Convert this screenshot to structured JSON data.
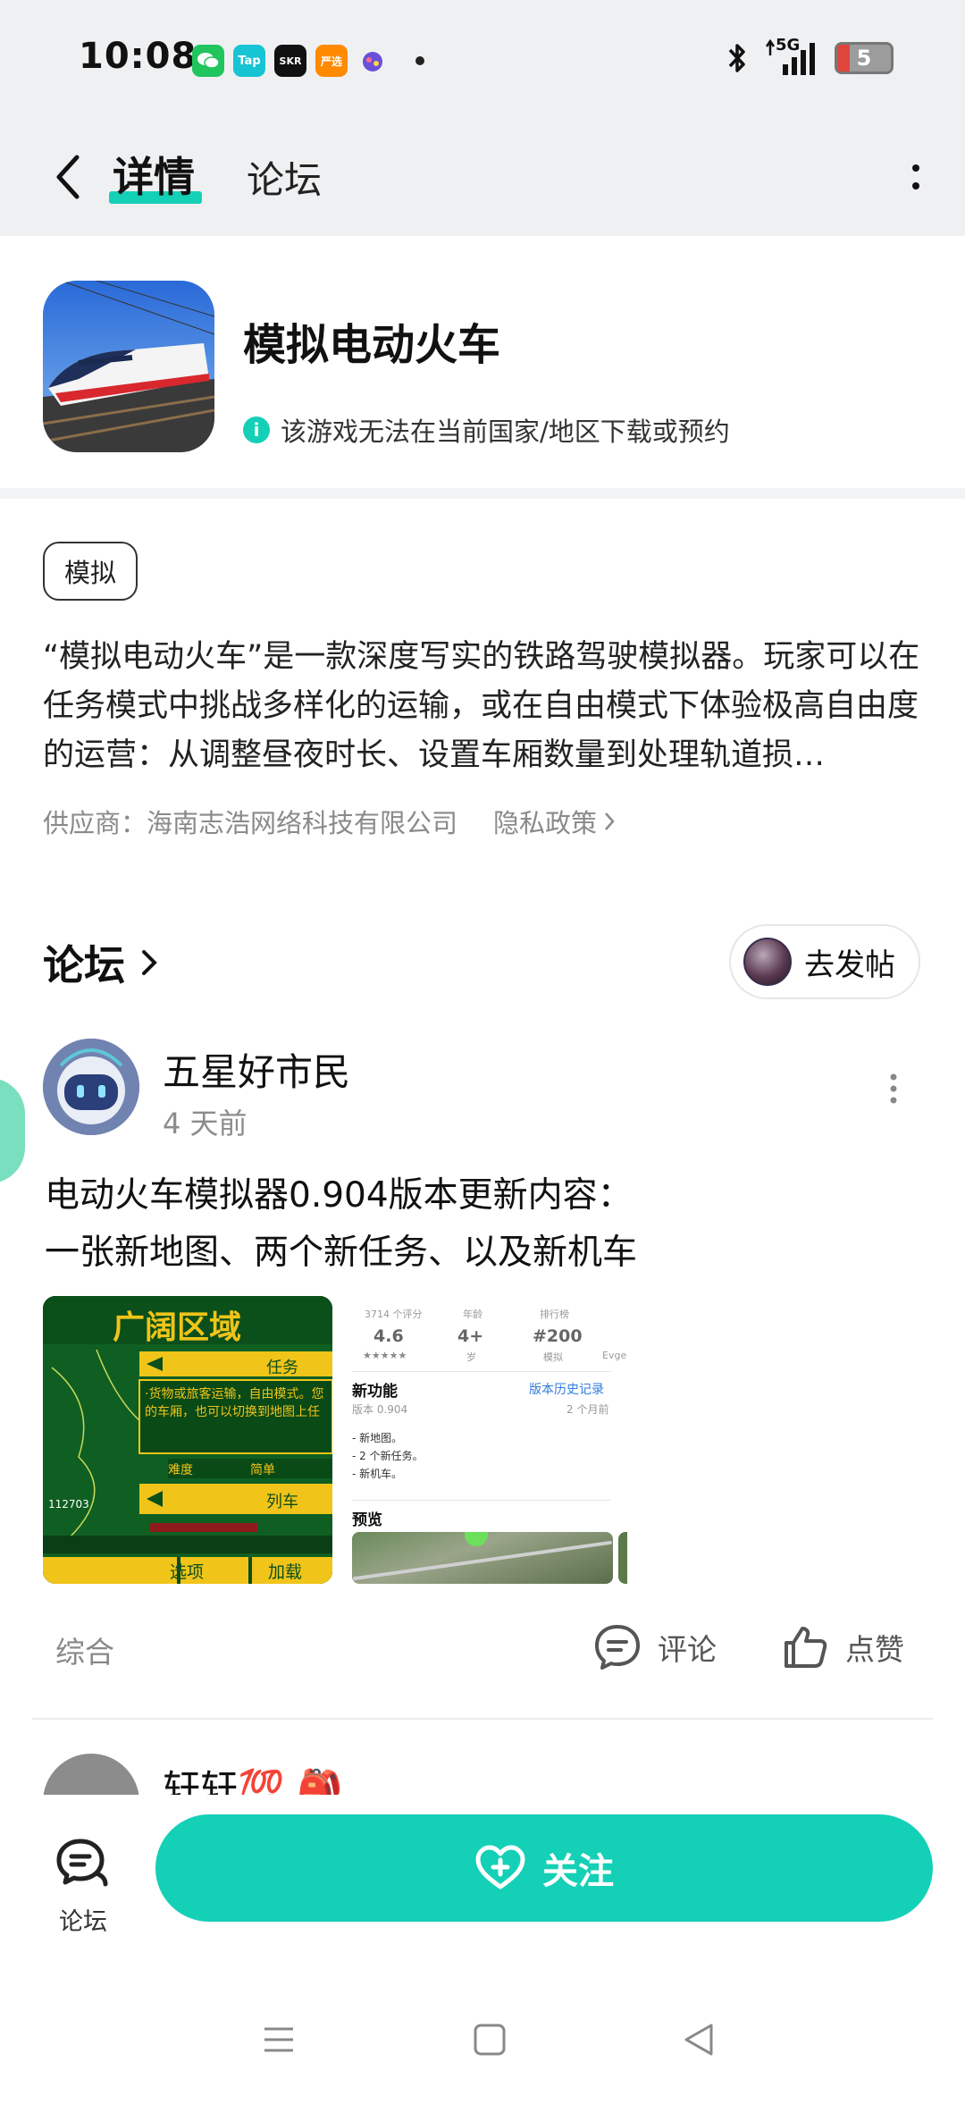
{
  "status_bar": {
    "time": "10:08",
    "apps": [
      {
        "name": "wechat-icon",
        "label": "",
        "color": "#20c55d"
      },
      {
        "name": "taptap-icon",
        "label": "Tap",
        "color": "#16c4d4"
      },
      {
        "name": "skr-icon",
        "label": "SKR",
        "color": "#111111"
      },
      {
        "name": "shopping-icon",
        "label": "严选",
        "color": "#ff8a00"
      },
      {
        "name": "game-center-icon",
        "label": "",
        "color": "#6a4fd8"
      }
    ],
    "network": "5G",
    "battery": "5"
  },
  "nav": {
    "tab_detail": "详情",
    "tab_forum": "论坛",
    "accent": "#14d0b6"
  },
  "app": {
    "title": "模拟电动火车",
    "notice": "该游戏无法在当前国家/地区下载或预约"
  },
  "info": {
    "tag": "模拟",
    "description": "“模拟电动火车”是一款深度写实的铁路驾驶模拟器。玩家可以在任务模式中挑战多样化的运输，或在自由模式下体验极高自由度的运营：从调整昼夜时长、设置车厢数量到处理轨道损…",
    "supplier": "供应商：海南志浩网络科技有限公司",
    "privacy": "隐私政策"
  },
  "forum": {
    "title": "论坛",
    "post_button": "去发帖",
    "post": {
      "user": "五星好市民",
      "time": "4 天前",
      "text": "电动火车模拟器0.904版本更新内容：\n 一张新地图、两个新任务、以及新机车",
      "thumb1": {
        "title": "广阔区域",
        "task_label": "任务",
        "task_desc": "·货物或旅客运输，自由模式。您的车厢，也可以切换到地图上任意",
        "difficulty": "难度",
        "difficulty_value": "简单",
        "train_label": "列车",
        "btn_options": "选项",
        "btn_load": "加载",
        "counter": "112703"
      },
      "thumb2": {
        "ratings_label": "3714 个评分",
        "rating": "4.6",
        "age_label": "年龄",
        "age": "4+",
        "age_sub": "岁",
        "rank_label": "排行榜",
        "rank": "#200",
        "rank_sub": "模拟",
        "dev": "Evger",
        "new_features": "新功能",
        "history": "版本历史记录",
        "version": "版本 0.904",
        "months": "2 个月前",
        "notes": [
          "- 新地图。",
          "- 2 个新任务。",
          "- 新机车。"
        ],
        "preview": "预览"
      },
      "category": "综合",
      "comment": "评论",
      "like": "点赞"
    },
    "next_user": "轩轩💯 🎒"
  },
  "bottom": {
    "forum_label": "论坛",
    "follow": "关注"
  }
}
